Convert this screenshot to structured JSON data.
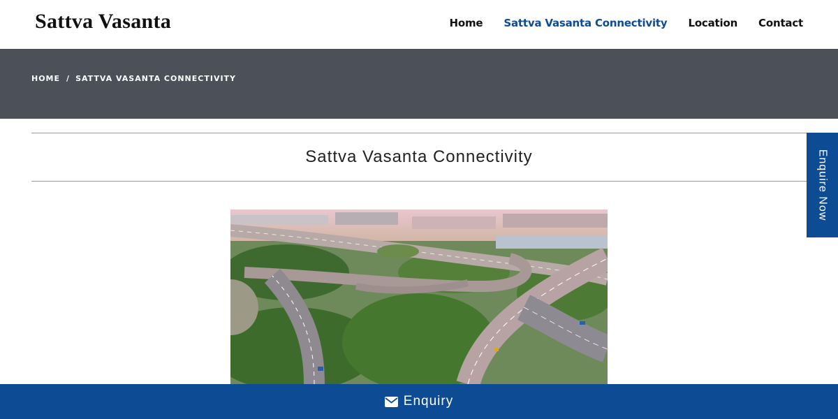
{
  "header": {
    "logo_text": "Sattva Vasanta",
    "nav": [
      {
        "label": "Home"
      },
      {
        "label": "Sattva Vasanta Connectivity"
      },
      {
        "label": "Location"
      },
      {
        "label": "Contact"
      }
    ]
  },
  "breadcrumb": {
    "home": "HOME",
    "separator": "/",
    "current": "SATTVA VASANTA CONNECTIVITY"
  },
  "main": {
    "title": "Sattva Vasanta Connectivity",
    "image_icon": "aerial-highway-interchange-photo"
  },
  "side_tab": {
    "label": "Enquire Now"
  },
  "footer_bar": {
    "icon": "envelope-icon",
    "label": "Enquiry"
  },
  "colors": {
    "accent": "#0d4c94",
    "banner": "#4c5058",
    "text": "#111111"
  }
}
